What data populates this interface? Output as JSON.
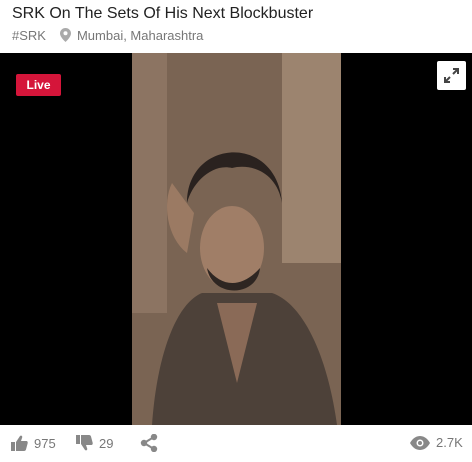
{
  "post": {
    "title": "SRK On The Sets Of His Next Blockbuster",
    "hashtag": "#SRK",
    "location": "Mumbai, Maharashtra"
  },
  "player": {
    "live_label": "Live"
  },
  "stats": {
    "likes": "975",
    "dislikes": "29",
    "views": "2.7K"
  },
  "icons": {
    "location": "map-pin-icon",
    "expand": "expand-icon",
    "like": "thumbs-up-icon",
    "dislike": "thumbs-down-icon",
    "share": "share-icon",
    "views": "eye-icon"
  },
  "colors": {
    "live_badge": "#d5153a",
    "icon_gray": "#888888",
    "player_bg": "#000000"
  }
}
